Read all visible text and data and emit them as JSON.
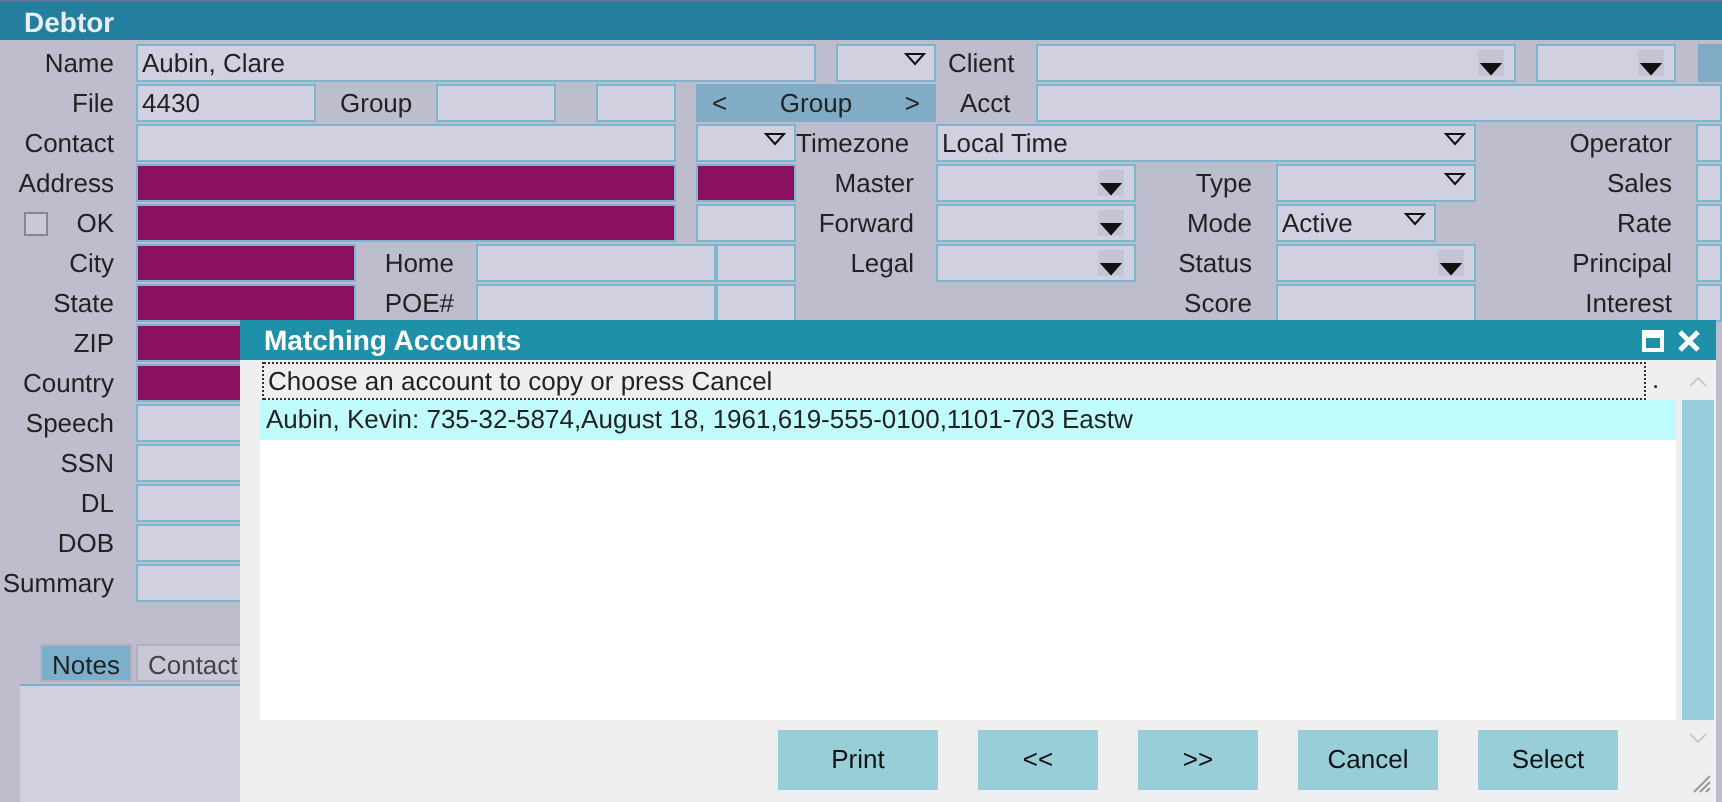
{
  "window": {
    "title": "Debtor"
  },
  "form": {
    "rows": [
      {
        "items": [
          {
            "kind": "label",
            "text": "Name"
          },
          {
            "kind": "field",
            "value": "Aubin, Clare",
            "required": false
          },
          {
            "kind": "combo"
          },
          {
            "kind": "label",
            "text": "Client"
          },
          {
            "kind": "dropdown"
          },
          {
            "kind": "dropdown"
          },
          {
            "kind": "button"
          }
        ]
      },
      {
        "items": [
          {
            "kind": "label",
            "text": "File"
          },
          {
            "kind": "field",
            "value": "4430",
            "required": false
          },
          {
            "kind": "label",
            "text": "Group"
          },
          {
            "kind": "field",
            "required": false
          },
          {
            "kind": "field",
            "required": false
          },
          {
            "kind": "nav",
            "prev": "<",
            "label": "Group",
            "next": ">"
          },
          {
            "kind": "label",
            "text": "Acct"
          },
          {
            "kind": "field",
            "required": false
          }
        ]
      },
      {
        "items": [
          {
            "kind": "label",
            "text": "Contact"
          },
          {
            "kind": "field",
            "required": false
          },
          {
            "kind": "combo"
          },
          {
            "kind": "label",
            "text": "Timezone"
          },
          {
            "kind": "combo",
            "value": "Local Time"
          },
          {
            "kind": "label",
            "text": "Operator"
          },
          {
            "kind": "field",
            "required": false
          }
        ]
      },
      {
        "items": [
          {
            "kind": "label",
            "text": "Address"
          },
          {
            "kind": "field",
            "required": true
          },
          {
            "kind": "field",
            "required": true
          },
          {
            "kind": "label",
            "text": "Master"
          },
          {
            "kind": "dropdown"
          },
          {
            "kind": "label",
            "text": "Type"
          },
          {
            "kind": "combo"
          },
          {
            "kind": "label",
            "text": "Sales"
          },
          {
            "kind": "field",
            "required": false
          }
        ]
      },
      {
        "items": [
          {
            "kind": "checkbox",
            "text": "OK",
            "checked": false
          },
          {
            "kind": "field",
            "required": true
          },
          {
            "kind": "field",
            "required": false
          },
          {
            "kind": "label",
            "text": "Forward"
          },
          {
            "kind": "dropdown"
          },
          {
            "kind": "label",
            "text": "Mode"
          },
          {
            "kind": "combo",
            "value": "Active"
          },
          {
            "kind": "label",
            "text": "Rate"
          },
          {
            "kind": "field",
            "required": false
          }
        ]
      },
      {
        "items": [
          {
            "kind": "label",
            "text": "City"
          },
          {
            "kind": "field",
            "required": true
          },
          {
            "kind": "label",
            "text": "Home"
          },
          {
            "kind": "field",
            "required": false
          },
          {
            "kind": "field",
            "required": false
          },
          {
            "kind": "label",
            "text": "Legal"
          },
          {
            "kind": "dropdown"
          },
          {
            "kind": "label",
            "text": "Status"
          },
          {
            "kind": "dropdown"
          },
          {
            "kind": "label",
            "text": "Principal"
          },
          {
            "kind": "field",
            "required": false
          }
        ]
      },
      {
        "items": [
          {
            "kind": "label",
            "text": "State"
          },
          {
            "kind": "field",
            "required": true
          },
          {
            "kind": "label",
            "text": "POE#"
          },
          {
            "kind": "field",
            "required": false
          },
          {
            "kind": "field",
            "required": false
          },
          {
            "kind": "label",
            "text": "Score"
          },
          {
            "kind": "field",
            "required": false
          },
          {
            "kind": "label",
            "text": "Interest"
          },
          {
            "kind": "field",
            "required": false
          }
        ]
      },
      {
        "items": [
          {
            "kind": "label",
            "text": "ZIP"
          },
          {
            "kind": "field",
            "required": true
          }
        ]
      },
      {
        "items": [
          {
            "kind": "label",
            "text": "Country"
          },
          {
            "kind": "field",
            "required": true
          }
        ]
      },
      {
        "items": [
          {
            "kind": "label",
            "text": "Speech"
          },
          {
            "kind": "field",
            "required": false
          }
        ]
      },
      {
        "items": [
          {
            "kind": "label",
            "text": "SSN"
          },
          {
            "kind": "field",
            "required": false
          }
        ]
      },
      {
        "items": [
          {
            "kind": "label",
            "text": "DL"
          },
          {
            "kind": "field",
            "required": false
          }
        ]
      },
      {
        "items": [
          {
            "kind": "label",
            "text": "DOB"
          },
          {
            "kind": "field",
            "required": false
          }
        ]
      },
      {
        "items": [
          {
            "kind": "label",
            "text": "Summary"
          },
          {
            "kind": "field",
            "required": false
          }
        ]
      }
    ]
  },
  "tabs": [
    {
      "label": "Notes",
      "selected": true
    },
    {
      "label": "Contact",
      "selected": false
    }
  ],
  "dialog": {
    "title": "Matching Accounts",
    "prompt": "Choose an account to copy or press Cancel",
    "prompt_tail": ".",
    "rows": [
      {
        "text": "Aubin, Kevin:  735-32-5874,August 18, 1961,619-555-0100,1101-703 Eastw",
        "selected": true
      }
    ],
    "buttons": [
      {
        "label": "Print"
      },
      {
        "label": "<<"
      },
      {
        "label": ">>"
      },
      {
        "label": "Cancel"
      },
      {
        "label": "Select"
      }
    ]
  }
}
